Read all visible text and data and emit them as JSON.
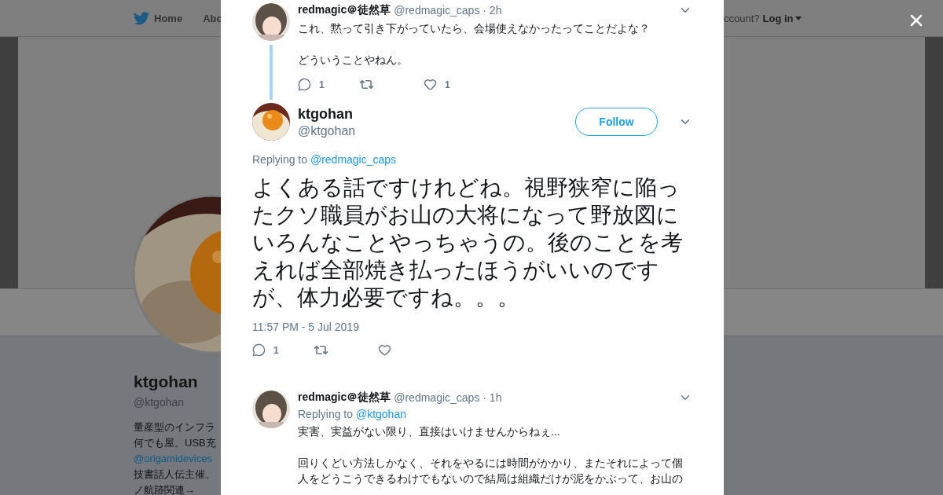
{
  "background_page": {
    "nav": {
      "items": [
        {
          "label": "Home",
          "kind": "home"
        },
        {
          "label": "Abo",
          "kind": "plain"
        }
      ],
      "account_prompt": "ccount?",
      "login": "Log in"
    },
    "profile": {
      "name": "ktgohan",
      "handle": "@ktgohan",
      "bio": [
        {
          "text": "量産型のインフラ",
          "kind": "text"
        },
        {
          "text": "何でも屋。USB充",
          "kind": "text"
        },
        {
          "text": "@origamidevices",
          "kind": "link"
        },
        {
          "text": "技書話人伝主催。",
          "kind": "text"
        },
        {
          "text": "ノ航跡関連→",
          "kind": "text"
        }
      ]
    }
  },
  "modal": {
    "tweets": [
      {
        "kind": "context",
        "name": "redmagic＠徒然草",
        "handle": "@redmagic_caps",
        "time": "· 2h",
        "paragraphs": [
          "これ、黙って引き下がっていたら、会場使えなかったってことだよな？",
          "どういうことやねん。"
        ],
        "actions": {
          "replies": "1",
          "likes": "1"
        }
      },
      {
        "kind": "main",
        "name": "ktgohan",
        "handle": "@ktgohan",
        "follow": "Follow",
        "replying_label": "Replying to",
        "replying_to": "@redmagic_caps",
        "paragraphs": [
          "よくある話ですけれどね。視野狭窄に陥ったクソ職員がお山の大将になって野放図にいろんなことやっちゃうの。後のことを考えれば全部焼き払ったほうがいいのですが、体力必要ですね。。。"
        ],
        "timestamp": "11:57 PM - 5 Jul 2019",
        "actions": {
          "replies": "1"
        }
      },
      {
        "kind": "reply",
        "name": "redmagic＠徒然草",
        "handle": "@redmagic_caps",
        "time": "· 1h",
        "replying_label": "Replying to",
        "replying_to": "@ktgohan",
        "paragraphs": [
          "実害、実益がない限り、直接はいけませんからねぇ...",
          "回りくどい方法しかなく、それをやるには時間がかかり、またそれによって個人をどうこうできるわけでもないので結局は組織だけが泥をかぶって、お山の"
        ]
      }
    ]
  }
}
